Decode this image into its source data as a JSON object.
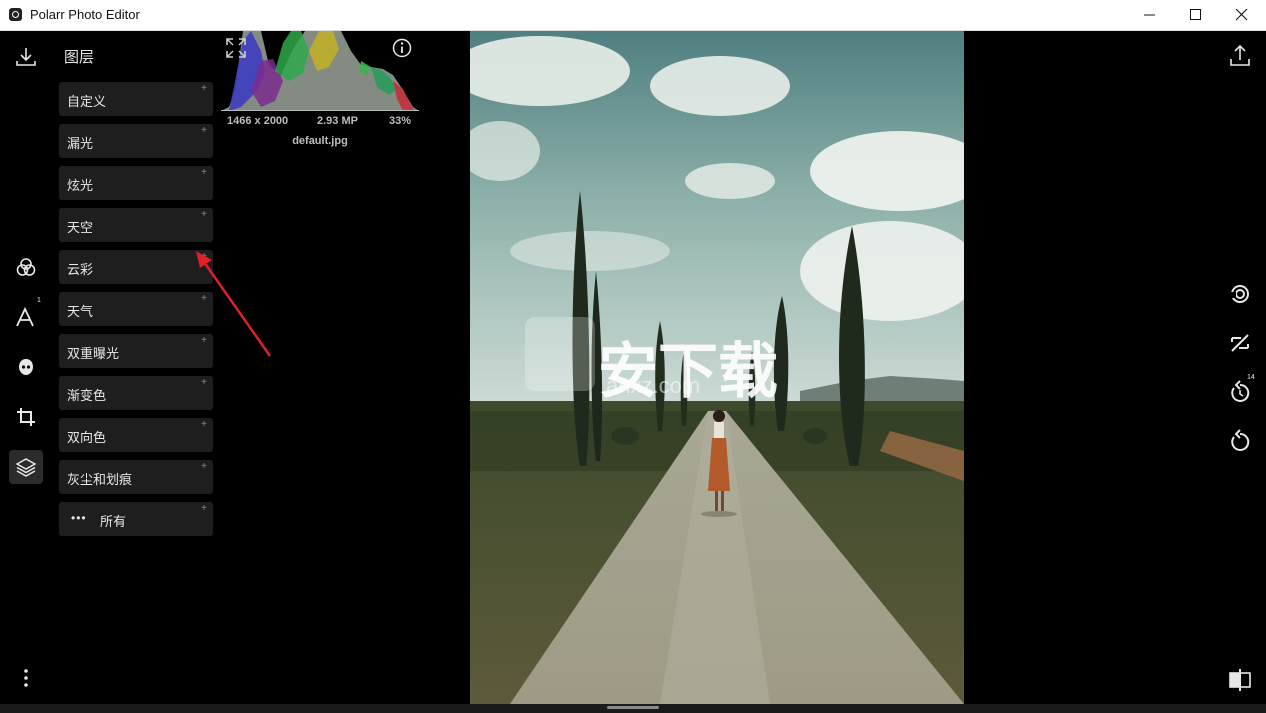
{
  "window": {
    "title": "Polarr Photo Editor",
    "controls": [
      "minimize-icon",
      "maximize-icon",
      "close-icon"
    ]
  },
  "left_toolbar": {
    "items": [
      {
        "icon": "download-icon"
      },
      {
        "icon": "color-circles-icon"
      },
      {
        "icon": "text-icon",
        "badge": "1"
      },
      {
        "icon": "face-icon"
      },
      {
        "icon": "crop-icon"
      },
      {
        "icon": "layers-icon",
        "active": true
      },
      {
        "icon": "more-vertical-icon"
      }
    ]
  },
  "panel": {
    "title": "图层",
    "layers": [
      {
        "label": "自定义"
      },
      {
        "label": "漏光"
      },
      {
        "label": "炫光"
      },
      {
        "label": "天空"
      },
      {
        "label": "云彩"
      },
      {
        "label": "天气"
      },
      {
        "label": "双重曝光"
      },
      {
        "label": "渐变色"
      },
      {
        "label": "双向色"
      },
      {
        "label": "灰尘和划痕"
      },
      {
        "label": "所有"
      }
    ],
    "add_symbol": "+"
  },
  "histogram": {
    "resolution": "1466 x 2000",
    "megapixels": "2.93 MP",
    "zoom": "33%",
    "filename": "default.jpg"
  },
  "photo": {
    "watermark": "安下载",
    "watermark_sub": "anxz.com"
  },
  "right_toolbar": {
    "items": [
      {
        "icon": "share-icon"
      },
      {
        "icon": "spiral-icon"
      },
      {
        "icon": "hide-edits-icon"
      },
      {
        "icon": "history-icon",
        "badge": "14"
      },
      {
        "icon": "reset-icon"
      },
      {
        "icon": "compare-icon"
      }
    ]
  },
  "colors": {
    "background": "#000000",
    "panel_button": "#1e1e1e",
    "active_tool": "#2b2b2b",
    "annotation_arrow": "#e0202a"
  }
}
